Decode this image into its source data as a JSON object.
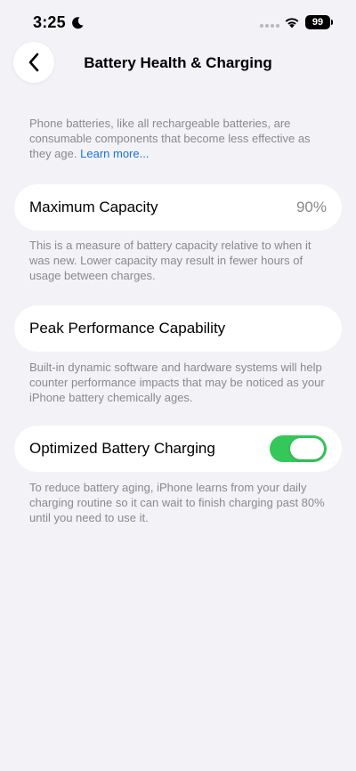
{
  "status_bar": {
    "time": "3:25",
    "battery_level": "99"
  },
  "nav": {
    "title": "Battery Health & Charging"
  },
  "intro": {
    "text": "Phone batteries, like all rechargeable batteries, are consumable components that become less effective as they age.",
    "link_label": "Learn more..."
  },
  "maximum_capacity": {
    "label": "Maximum Capacity",
    "value": "90%",
    "description": "This is a measure of battery capacity relative to when it was new. Lower capacity may result in fewer hours of usage between charges."
  },
  "peak_performance": {
    "label": "Peak Performance Capability",
    "description": "Built-in dynamic software and hardware systems will help counter performance impacts that may be noticed as your iPhone battery chemically ages."
  },
  "optimized_charging": {
    "label": "Optimized Battery Charging",
    "enabled": true,
    "description": "To reduce battery aging, iPhone learns from your daily charging routine so it can wait to finish charging past 80% until you need to use it."
  },
  "colors": {
    "background": "#f2f2f7",
    "card": "#ffffff",
    "secondary_text": "#8a8a8e",
    "link": "#1a73d9",
    "toggle_on": "#34c759"
  }
}
